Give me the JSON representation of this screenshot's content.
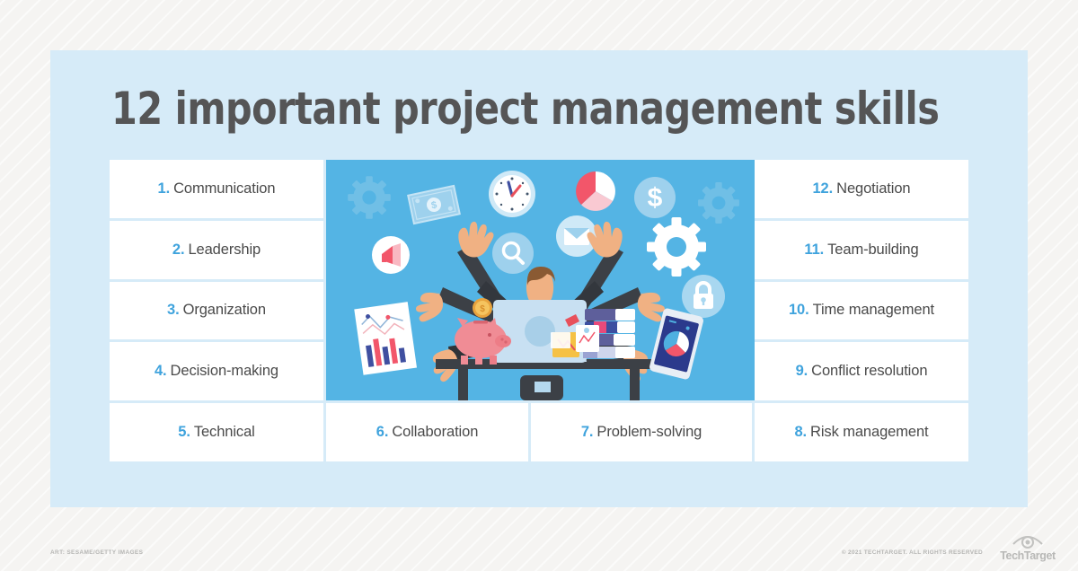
{
  "title": "12 important project management skills",
  "colors": {
    "accent_blue": "#3fa3dd",
    "panel_bg": "#d6ebf8",
    "illustration_bg": "#54b4e4",
    "text_dark": "#4a4a4a",
    "page_bg": "#f5f4f2"
  },
  "skills": {
    "left_column": [
      {
        "num": "1.",
        "label": "Communication"
      },
      {
        "num": "2.",
        "label": "Leadership"
      },
      {
        "num": "3.",
        "label": "Organization"
      },
      {
        "num": "4.",
        "label": "Decision-making"
      }
    ],
    "right_column": [
      {
        "num": "12.",
        "label": "Negotiation"
      },
      {
        "num": "11.",
        "label": "Team-building"
      },
      {
        "num": "10.",
        "label": "Time management"
      },
      {
        "num": "9.",
        "label": "Conflict resolution"
      }
    ],
    "bottom_row": [
      {
        "num": "5.",
        "label": "Technical"
      },
      {
        "num": "6.",
        "label": "Collaboration"
      },
      {
        "num": "7.",
        "label": "Problem-solving"
      },
      {
        "num": "8.",
        "label": "Risk management"
      }
    ]
  },
  "illustration": {
    "description": "Businessman multitasking with eight arms at a desk",
    "icons": [
      "gear-icon",
      "banknote-icon",
      "clock-icon",
      "pie-chart-icon",
      "dollar-coin-icon",
      "megaphone-icon",
      "magnifier-icon",
      "envelope-icon",
      "lock-icon",
      "gear-icon",
      "gear-icon",
      "bar-chart-paper-icon",
      "piggy-bank-icon",
      "laptop-icon",
      "binders-icon",
      "folder-icon",
      "tablet-icon"
    ]
  },
  "footer": {
    "art_credit": "ART: SESAME/GETTY IMAGES",
    "copyright": "© 2021 TECHTARGET. ALL RIGHTS RESERVED",
    "brand": "TechTarget"
  }
}
